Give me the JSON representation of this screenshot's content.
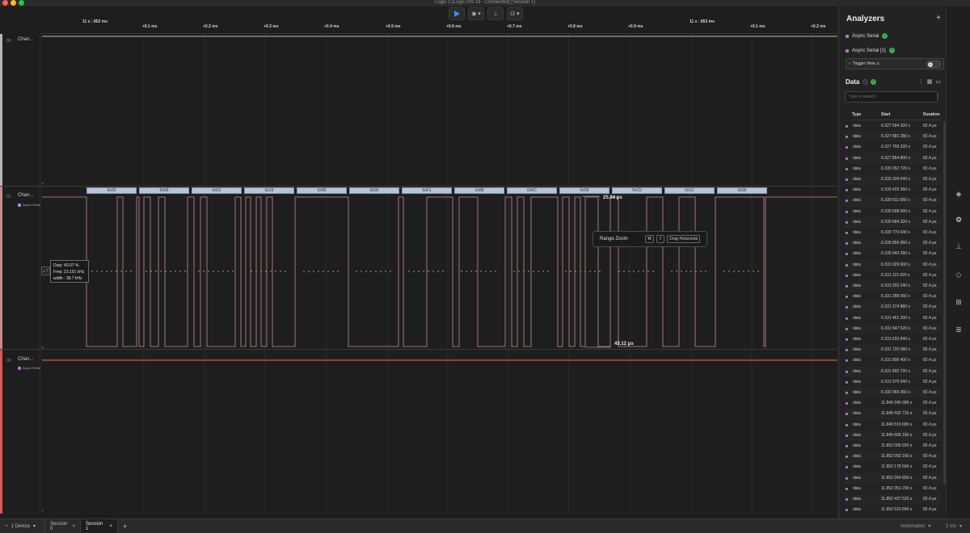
{
  "window": {
    "title": "Logic 2 [Logic Pro 16 - Connected] [Session 1]",
    "traffic_colors": [
      "#ff5f57",
      "#febc2e",
      "#28c840"
    ]
  },
  "toolbar": {
    "play_icon": "play-icon",
    "play_color": "#3b8cf0",
    "caret": "▾"
  },
  "ruler": {
    "ticks": [
      "11 s : 852 ms",
      "+0.1 ms",
      "+0.2 ms",
      "+0.3 ms",
      "+0.4 ms",
      "+0.5 ms",
      "+0.6 ms",
      "+0.7 ms",
      "+0.8 ms",
      "+0.9 ms",
      "11 s : 853 ms",
      "+0.1 ms",
      "+0.2 ms"
    ]
  },
  "channels": [
    {
      "num": "00",
      "name": "Chan...",
      "color": "#b8b8b8",
      "analyzer": ""
    },
    {
      "num": "01",
      "name": "Chan...",
      "color": "#c98b8b",
      "analyzer": "Async Serial",
      "analyzer_color": "#9b8fe3"
    },
    {
      "num": "02",
      "name": "Chan...",
      "color": "#e05555",
      "analyzer": "Async Serial",
      "analyzer_color": "#c76bd8"
    }
  ],
  "bytes": [
    "0x20",
    "0x09",
    "0x01",
    "0x15",
    "0x00",
    "0x00",
    "0xF1",
    "0x88",
    "0x0C",
    "0x09",
    "0xC0",
    "0x1C",
    "0x00"
  ],
  "measurement": {
    "icon": "⊥⊤",
    "duty": "Duty: 40.07 %",
    "freq": "Freq: 23.191 kHz",
    "width": "width : 38.7 kHz"
  },
  "range_zoom": {
    "label": "Range Zoom",
    "key1": "⌘",
    "key2": "⇧",
    "action": "Drag Horizontal"
  },
  "dimensions": {
    "upper": "25.84 μs",
    "lower": "43.12 μs"
  },
  "sidebar": {
    "title": "Analyzers",
    "add": "+",
    "analyzers": [
      {
        "name": "Async Serial",
        "color": "#8a8ad0"
      },
      {
        "name": "Async Serial [1]",
        "color": "#c76bd8"
      }
    ],
    "trigger_view": "Trigger View ⚠",
    "data_title": "Data",
    "search_placeholder": "Type to search",
    "columns": {
      "type": "Type",
      "start": "Start",
      "duration": "Duration"
    }
  },
  "rows": [
    {
      "type": "data",
      "start": "6.327 594 320 s",
      "duration": "82.4 μs",
      "color": "#c76bd8"
    },
    {
      "type": "data",
      "start": "6.327 681 280 s",
      "duration": "82.4 μs",
      "color": "#c76bd8"
    },
    {
      "type": "data",
      "start": "6.327 768 320 s",
      "duration": "82.4 μs",
      "color": "#c76bd8"
    },
    {
      "type": "data",
      "start": "6.327 854 800 s",
      "duration": "82.4 μs",
      "color": "#c76bd8"
    },
    {
      "type": "data",
      "start": "6.330 252 720 s",
      "duration": "82.4 μs",
      "color": "#8a8ad0"
    },
    {
      "type": "data",
      "start": "6.330 339 040 s",
      "duration": "82.4 μs",
      "color": "#8a8ad0"
    },
    {
      "type": "data",
      "start": "6.330 425 360 s",
      "duration": "82.4 μs",
      "color": "#8a8ad0"
    },
    {
      "type": "data",
      "start": "6.330 511 680 s",
      "duration": "82.4 μs",
      "color": "#8a8ad0"
    },
    {
      "type": "data",
      "start": "6.330 598 000 s",
      "duration": "82.4 μs",
      "color": "#8a8ad0"
    },
    {
      "type": "data",
      "start": "6.330 684 320 s",
      "duration": "82.4 μs",
      "color": "#8a8ad0"
    },
    {
      "type": "data",
      "start": "6.330 770 640 s",
      "duration": "82.4 μs",
      "color": "#8a8ad0"
    },
    {
      "type": "data",
      "start": "6.330 856 960 s",
      "duration": "82.4 μs",
      "color": "#8a8ad0"
    },
    {
      "type": "data",
      "start": "6.330 943 280 s",
      "duration": "82.4 μs",
      "color": "#8a8ad0"
    },
    {
      "type": "data",
      "start": "6.331 029 600 s",
      "duration": "82.4 μs",
      "color": "#8a8ad0"
    },
    {
      "type": "data",
      "start": "6.331 115 920 s",
      "duration": "82.4 μs",
      "color": "#8a8ad0"
    },
    {
      "type": "data",
      "start": "6.331 202 240 s",
      "duration": "82.4 μs",
      "color": "#8a8ad0"
    },
    {
      "type": "data",
      "start": "6.331 288 560 s",
      "duration": "82.4 μs",
      "color": "#8a8ad0"
    },
    {
      "type": "data",
      "start": "6.331 374 880 s",
      "duration": "82.4 μs",
      "color": "#8a8ad0"
    },
    {
      "type": "data",
      "start": "6.331 461 200 s",
      "duration": "82.4 μs",
      "color": "#8a8ad0"
    },
    {
      "type": "data",
      "start": "6.331 547 520 s",
      "duration": "82.4 μs",
      "color": "#8a8ad0"
    },
    {
      "type": "data",
      "start": "6.331 633 840 s",
      "duration": "82.4 μs",
      "color": "#8a8ad0"
    },
    {
      "type": "data",
      "start": "6.331 720 080 s",
      "duration": "82.4 μs",
      "color": "#8a8ad0"
    },
    {
      "type": "data",
      "start": "6.331 806 400 s",
      "duration": "82.4 μs",
      "color": "#8a8ad0"
    },
    {
      "type": "data",
      "start": "6.331 892 720 s",
      "duration": "82.4 μs",
      "color": "#8a8ad0"
    },
    {
      "type": "data",
      "start": "6.331 979 040 s",
      "duration": "82.4 μs",
      "color": "#8a8ad0"
    },
    {
      "type": "data",
      "start": "6.332 065 360 s",
      "duration": "82.4 μs",
      "color": "#8a8ad0"
    },
    {
      "type": "data",
      "start": "11.849 345 680 s",
      "duration": "82.4 μs",
      "color": "#c76bd8"
    },
    {
      "type": "data",
      "start": "11.849 432 720 s",
      "duration": "82.4 μs",
      "color": "#c76bd8"
    },
    {
      "type": "data",
      "start": "11.849 519 680 s",
      "duration": "82.4 μs",
      "color": "#c76bd8"
    },
    {
      "type": "data",
      "start": "11.849 606 160 s",
      "duration": "82.4 μs",
      "color": "#c76bd8"
    },
    {
      "type": "data",
      "start": "11.852 005 920 s",
      "duration": "82.4 μs",
      "color": "#8a8ad0"
    },
    {
      "type": "data",
      "start": "11.852 092 160 s",
      "duration": "82.4 μs",
      "color": "#8a8ad0"
    },
    {
      "type": "data",
      "start": "11.852 178 560 s",
      "duration": "82.4 μs",
      "color": "#8a8ad0"
    },
    {
      "type": "data",
      "start": "11.852 264 800 s",
      "duration": "82.4 μs",
      "color": "#8a8ad0"
    },
    {
      "type": "data",
      "start": "11.852 351 200 s",
      "duration": "82.4 μs",
      "color": "#8a8ad0"
    },
    {
      "type": "data",
      "start": "11.852 437 520 s",
      "duration": "82.4 μs",
      "color": "#8a8ad0"
    },
    {
      "type": "data",
      "start": "11.852 523 840 s",
      "duration": "82.4 μs",
      "color": "#8a8ad0"
    }
  ],
  "bottom": {
    "device": "1 Device",
    "session0": "Session 0",
    "session1": "Session 1",
    "add_tab": "+",
    "automation": "Automation",
    "zoom": "1 ms",
    "caret": "▾",
    "close": "×"
  },
  "rail_icons": [
    "layers-icon",
    "settings-icon",
    "timing-icon",
    "marker-icon",
    "extensions-icon",
    "notes-icon"
  ]
}
